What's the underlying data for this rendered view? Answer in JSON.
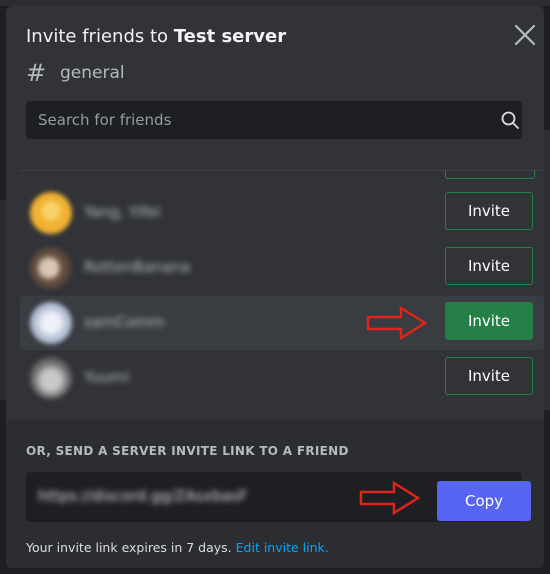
{
  "modal": {
    "title_prefix": "Invite friends to",
    "server_name": "Test server",
    "channel_symbol": "#",
    "channel_name": "general",
    "close_label": "Close"
  },
  "search": {
    "placeholder": "Search for friends",
    "value": ""
  },
  "friends": [
    {
      "name": "Yang, Yifei",
      "button": "Invite",
      "active": false,
      "avatar_color": "#f0b232"
    },
    {
      "name": "RottenBanana",
      "button": "Invite",
      "active": false,
      "avatar_color": "#8a6f5c"
    },
    {
      "name": "samComm",
      "button": "Invite",
      "active": true,
      "avatar_color": "#c4ccdc"
    },
    {
      "name": "Yuumi",
      "button": "Invite",
      "active": false,
      "avatar_color": "#9a9a9a"
    }
  ],
  "invite_link": {
    "section_label": "OR, SEND A SERVER INVITE LINK TO A FRIEND",
    "url": "https://discord.gg/ZAsxbasF",
    "copy_label": "Copy",
    "expire_text": "Your invite link expires in 7 days.",
    "edit_link_text": "Edit invite link."
  },
  "icons": {
    "close": "close-icon",
    "search": "search-icon",
    "channel": "hashtag-icon",
    "annotation": "red-arrow-icon"
  },
  "colors": {
    "modal_bg": "#313338",
    "footer_bg": "#2b2d31",
    "invite_green": "#248046",
    "copy_blurple": "#5865f2",
    "link_blue": "#00a8fc",
    "arrow_red": "#e0241b"
  }
}
